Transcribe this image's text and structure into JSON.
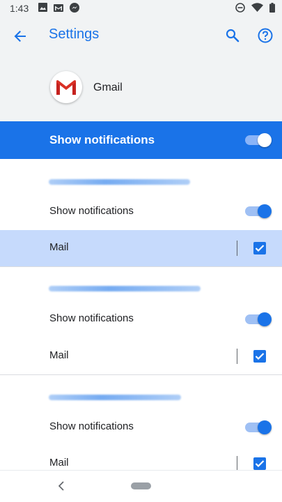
{
  "status_bar": {
    "time": "1:43",
    "left_icons": [
      "image-icon",
      "gmail-notification-icon",
      "messenger-icon"
    ],
    "right_icons": [
      "do-not-disturb-icon",
      "wifi-icon",
      "battery-icon"
    ]
  },
  "app_bar": {
    "title": "Settings",
    "icons": [
      "back-arrow-icon",
      "search-icon",
      "help-icon"
    ]
  },
  "app": {
    "name": "Gmail"
  },
  "master": {
    "label": "Show notifications",
    "enabled": true
  },
  "accounts": [
    {
      "name_redacted": true,
      "show_notifications": {
        "label": "Show notifications",
        "enabled": true
      },
      "mail": {
        "label": "Mail",
        "checked": true,
        "selected": true
      }
    },
    {
      "name_redacted": true,
      "show_notifications": {
        "label": "Show notifications",
        "enabled": true
      },
      "mail": {
        "label": "Mail",
        "checked": true,
        "selected": false
      }
    },
    {
      "name_redacted": true,
      "show_notifications": {
        "label": "Show notifications",
        "enabled": true
      },
      "mail": {
        "label": "Mail",
        "checked": true,
        "selected": false
      }
    }
  ],
  "colors": {
    "accent": "#1a73e8",
    "selected_row": "#c6dafc",
    "header_bg": "#f1f3f4"
  }
}
